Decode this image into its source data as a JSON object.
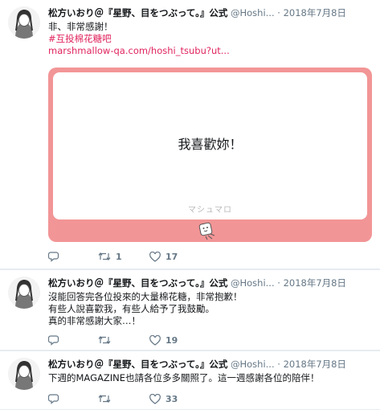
{
  "tweets": [
    {
      "name": "松方いおり＠『星野、目をつぶって。』公式",
      "handle": "@Hoshi...",
      "dot": "·",
      "time": "2018年7月8日",
      "lines": [
        "非、非常感謝！"
      ],
      "hashtag": "#互投棉花糖吧",
      "link": "marshmallow-qa.com/hoshi_tsubu?ut...",
      "card": {
        "question": "我喜歡妳！",
        "brand": "マシュマロ"
      },
      "retweets": "1",
      "likes": "17"
    },
    {
      "name": "松方いおり＠『星野、目をつぶって。』公式",
      "handle": "@Hoshi...",
      "dot": "·",
      "time": "2018年7月8日",
      "lines": [
        "沒能回答完各位投來的大量棉花糖，非常抱歉！",
        "有些人說喜歡我，有些人給予了我鼓勵。",
        "真的非常感謝大家…！"
      ],
      "retweets": "",
      "likes": "19"
    },
    {
      "name": "松方いおり＠『星野、目をつぶって。』公式",
      "handle": "@Hoshi...",
      "dot": "·",
      "time": "2018年7月8日",
      "lines": [
        "下週的MAGAZINE也請各位多多關照了。這一週感謝各位的陪伴！"
      ],
      "retweets": "",
      "likes": "33"
    }
  ],
  "colors": {
    "accent": "#e0245e",
    "card": "#f29596",
    "muted": "#657786"
  },
  "icons": {
    "reply": "reply-icon",
    "retweet": "retweet-icon",
    "like": "heart-icon"
  }
}
